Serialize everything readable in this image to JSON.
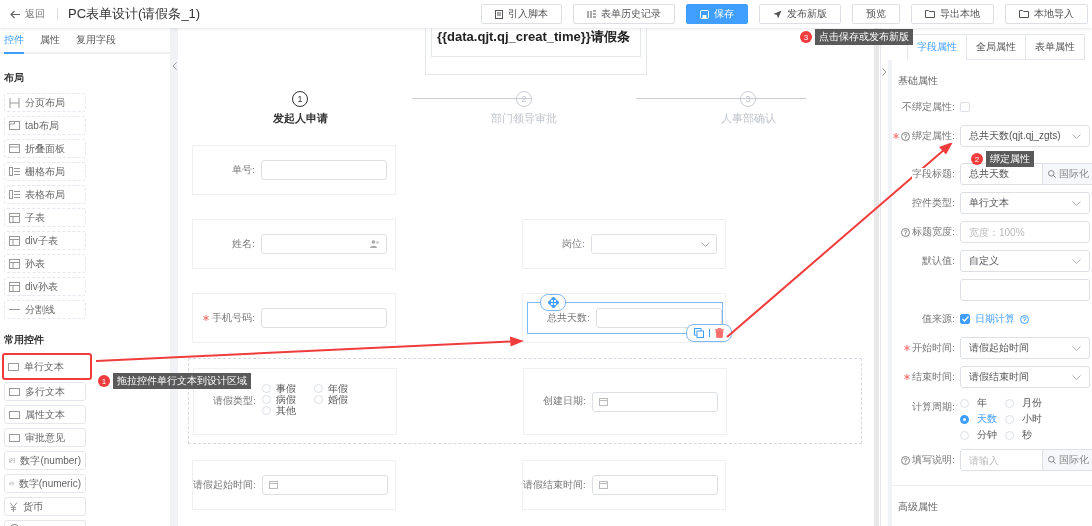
{
  "header": {
    "back": "返回",
    "title": "PC表单设计(请假条_1)",
    "buttons": [
      {
        "label": "引入脚本",
        "primary": false
      },
      {
        "label": "表单历史记录",
        "primary": false
      },
      {
        "label": "保存",
        "primary": true
      },
      {
        "label": "发布新版",
        "primary": false
      },
      {
        "label": "预览",
        "primary": false
      },
      {
        "label": "导出本地",
        "primary": false
      },
      {
        "label": "本地导入",
        "primary": false
      }
    ]
  },
  "sidebar": {
    "tabs": [
      {
        "label": "控件",
        "selected": true
      },
      {
        "label": "属性",
        "selected": false
      },
      {
        "label": "复用字段",
        "selected": false
      }
    ],
    "sections": [
      {
        "title": "布局",
        "items": [
          {
            "label": "分页布局",
            "highlighted": false
          },
          {
            "label": "tab布局",
            "highlighted": false
          },
          {
            "label": "折叠面板",
            "highlighted": false
          },
          {
            "label": "栅格布局",
            "highlighted": false
          },
          {
            "label": "表格布局",
            "highlighted": false
          },
          {
            "label": "子表",
            "highlighted": false
          },
          {
            "label": "div子表",
            "highlighted": false
          },
          {
            "label": "孙表",
            "highlighted": false
          },
          {
            "label": "div孙表",
            "highlighted": false
          },
          {
            "label": "分割线",
            "highlighted": false
          }
        ]
      },
      {
        "title": "常用控件",
        "items": [
          {
            "label": "单行文本",
            "highlighted": true
          },
          {
            "label": "多行文本",
            "highlighted": false
          },
          {
            "label": "属性文本",
            "highlighted": false
          },
          {
            "label": "审批意见",
            "highlighted": false
          },
          {
            "label": "数字(number)",
            "highlighted": false
          },
          {
            "label": "数字(numeric)",
            "highlighted": false
          },
          {
            "label": "货币",
            "highlighted": false
          },
          {
            "highlighted": false
          }
        ]
      }
    ]
  },
  "canvas": {
    "title_card": "{{data.qjt.qj_creat_time}}请假条",
    "steps": [
      {
        "number": "1",
        "label": "发起人申请",
        "active": true
      },
      {
        "number": "2",
        "label": "部门领导审批",
        "active": false
      },
      {
        "number": "3",
        "label": "人事部确认",
        "active": false
      }
    ],
    "rows": [
      {
        "grouped": false,
        "fields": [
          {
            "label": "单号:",
            "kind": "input",
            "required": false,
            "selected": false
          }
        ]
      },
      {
        "grouped": false,
        "fields": [
          {
            "label": "姓名:",
            "kind": "user",
            "required": false,
            "selected": false
          },
          {
            "label": "岗位:",
            "kind": "select",
            "required": false,
            "selected": false
          }
        ]
      },
      {
        "grouped": false,
        "fields": [
          {
            "label": "手机号码:",
            "kind": "input",
            "required": true,
            "selected": false
          },
          {
            "label": "总共天数:",
            "kind": "input",
            "required": false,
            "selected": true
          }
        ]
      },
      {
        "grouped": true,
        "fields": [
          {
            "label": "请假类型:",
            "kind": "radio",
            "required": false,
            "selected": false,
            "options": [
              "事假",
              "年假",
              "病假",
              "婚假",
              "其他"
            ]
          },
          {
            "label": "创建日期:",
            "kind": "date",
            "required": false,
            "selected": false
          }
        ]
      },
      {
        "grouped": false,
        "fields": [
          {
            "label": "请假起始时间:",
            "kind": "date",
            "required": false,
            "selected": false
          },
          {
            "label": "请假结束时间:",
            "kind": "date",
            "required": false,
            "selected": false
          }
        ]
      }
    ]
  },
  "properties": {
    "tabs": [
      {
        "label": "字段属性",
        "selected": true
      },
      {
        "label": "全局属性",
        "selected": false
      },
      {
        "label": "表单属性",
        "selected": false
      }
    ],
    "section": "基础属性",
    "rows": [
      {
        "kind": "checkbox",
        "label": "不绑定属性:",
        "checked": false
      },
      {
        "kind": "select",
        "label": "绑定属性:",
        "required": true,
        "help": true,
        "value": "总共天数(qjt.qj_zgts)"
      },
      {
        "kind": "i18n",
        "label": "字段标题:",
        "value": "总共天数",
        "button": "国际化"
      },
      {
        "kind": "select",
        "label": "控件类型:",
        "value": "单行文本"
      },
      {
        "kind": "input",
        "label": "标题宽度:",
        "help": true,
        "placeholder": "宽度：100%"
      },
      {
        "kind": "select",
        "label": "默认值:",
        "value": "自定义"
      },
      {
        "kind": "input"
      },
      {
        "kind": "checkbox",
        "label": "值来源:",
        "checked": true,
        "text": "日期计算",
        "help": true
      },
      {
        "kind": "select",
        "label": "开始时间:",
        "required": true,
        "value": "请假起始时间"
      },
      {
        "kind": "select",
        "label": "结束时间:",
        "required": true,
        "value": "请假结束时间"
      },
      {
        "kind": "radio",
        "label": "计算周期:",
        "options": [
          {
            "label": "年",
            "selected": false
          },
          {
            "label": "月份",
            "selected": false
          },
          {
            "label": "天数",
            "selected": true
          },
          {
            "label": "小时",
            "selected": false
          },
          {
            "label": "分钟",
            "selected": false
          },
          {
            "label": "秒",
            "selected": false
          }
        ]
      },
      {
        "kind": "i18n",
        "label": "填写说明:",
        "help": true,
        "placeholder": "请输入",
        "button": "国际化"
      }
    ],
    "advanced": "高级属性"
  },
  "annotations": [
    {
      "number": "1",
      "text": "拖拉控件单行文本到设计区域"
    },
    {
      "number": "2",
      "text": "绑定属性"
    },
    {
      "number": "3",
      "text": "点击保存或发布新版"
    }
  ]
}
